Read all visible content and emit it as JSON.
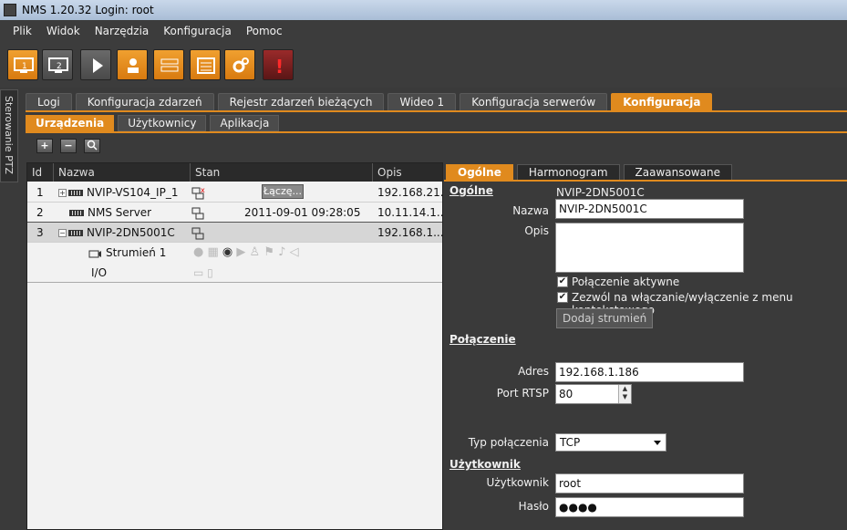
{
  "window": {
    "title": "NMS   1.20.32 Login: root"
  },
  "menu": [
    "Plik",
    "Widok",
    "Narzędzia",
    "Konfiguracja",
    "Pomoc"
  ],
  "toolbar": {
    "buttons": [
      {
        "icon": "monitor-1-icon",
        "label": "1"
      },
      {
        "icon": "monitor-2-icon",
        "label": "2"
      },
      {
        "icon": "play-icon"
      },
      {
        "icon": "user-icon"
      },
      {
        "icon": "device-list-icon"
      },
      {
        "icon": "grid-icon"
      },
      {
        "icon": "gears-icon"
      },
      {
        "icon": "alarm-icon",
        "label": "!"
      }
    ]
  },
  "ptz_tab": "Sterowanie PTZ",
  "main_tabs": [
    "Logi",
    "Konfiguracja zdarzeń",
    "Rejestr zdarzeń bieżących",
    "Wideo 1",
    "Konfiguracja serwerów",
    "Konfiguracja"
  ],
  "sub_tabs": [
    "Urządzenia",
    "Użytkownicy",
    "Aplikacja"
  ],
  "action_buttons": {
    "add": "+",
    "remove": "−"
  },
  "table": {
    "columns": [
      "Id",
      "Nazwa",
      "Stan",
      "Opis"
    ],
    "rows": [
      {
        "id": "1",
        "name": "NVIP-VS104_IP_1",
        "status": "Łączę...",
        "desc": "192.168.21..."
      },
      {
        "id": "2",
        "name": "NMS Server",
        "status": "2011-09-01 09:28:05",
        "desc": "10.11.14.1..."
      },
      {
        "id": "3",
        "name": "NVIP-2DN5001C",
        "status": "",
        "desc": "192.168.1...."
      },
      {
        "id": "",
        "name": "Strumień 1",
        "status": "",
        "desc": ""
      },
      {
        "id": "",
        "name": "I/O",
        "status": "",
        "desc": ""
      }
    ]
  },
  "detail_tabs": [
    "Ogólne",
    "Harmonogram",
    "Zaawansowane"
  ],
  "general": {
    "section": "Ogólne",
    "device_name": "NVIP-2DN5001C",
    "name_label": "Nazwa",
    "name_value": "NVIP-2DN5001C",
    "desc_label": "Opis",
    "desc_value": "",
    "active_label": "Połączenie aktywne",
    "menu_toggle_label": "Zezwól na włączanie/wyłączenie z menu kontekstowego",
    "add_stream_label": "Dodaj strumień"
  },
  "connection": {
    "section": "Połączenie",
    "address_label": "Adres",
    "address_value": "192.168.1.186",
    "rtsp_label": "Port RTSP",
    "rtsp_value": "80",
    "type_label": "Typ połączenia",
    "type_value": "TCP"
  },
  "user": {
    "section": "Użytkownik",
    "user_label": "Użytkownik",
    "user_value": "root",
    "pass_label": "Hasło",
    "pass_value": "●●●●"
  },
  "colors": {
    "accent": "#e08a1e",
    "background": "#3a3a3a",
    "table_bg": "#f2f2f2"
  }
}
